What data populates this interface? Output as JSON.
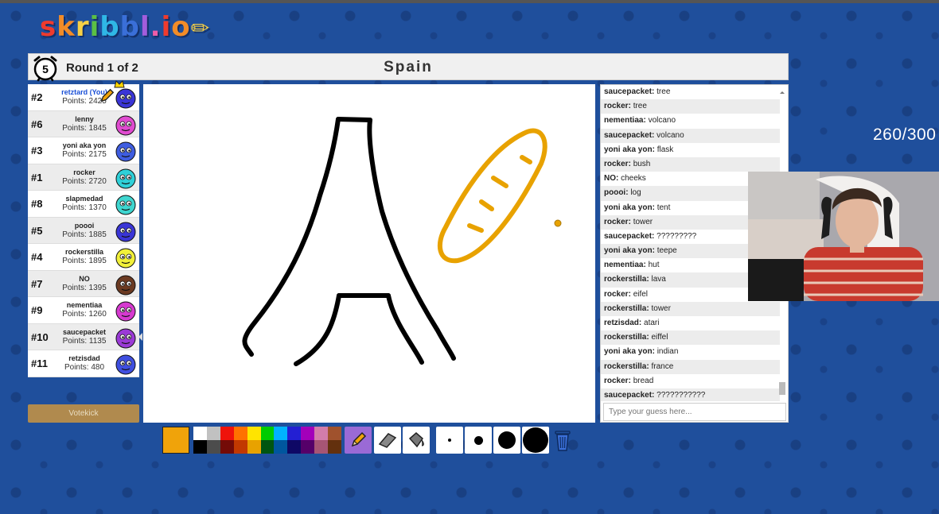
{
  "app": {
    "logo_letters": [
      "s",
      "k",
      "r",
      "i",
      "b",
      "b",
      "l",
      ".",
      "i",
      "o"
    ],
    "logo_colors": [
      "#ef3b2d",
      "#f28c28",
      "#f6d046",
      "#5bc044",
      "#2fb7e6",
      "#3a6fd8",
      "#a25ddc",
      "#ef5da8",
      "#ef3b2d",
      "#f28c28"
    ]
  },
  "header": {
    "timer": "5",
    "round": "Round 1 of 2",
    "word": "Spain"
  },
  "players": [
    {
      "rank": "#2",
      "name": "retztard (You)",
      "points": "Points: 2425",
      "self": true,
      "avatar": "#3a35d6",
      "drawing": true,
      "crown": true
    },
    {
      "rank": "#6",
      "name": "lenny",
      "points": "Points: 1845",
      "avatar": "#e04bd0"
    },
    {
      "rank": "#3",
      "name": "yoni aka yon",
      "points": "Points: 2175",
      "avatar": "#3f5de0"
    },
    {
      "rank": "#1",
      "name": "rocker",
      "points": "Points: 2720",
      "avatar": "#2fd0d8"
    },
    {
      "rank": "#8",
      "name": "slapmedad",
      "points": "Points: 1370",
      "avatar": "#3fd6d0"
    },
    {
      "rank": "#5",
      "name": "poooi",
      "points": "Points: 1885",
      "avatar": "#3a35d6"
    },
    {
      "rank": "#4",
      "name": "rockerstilla",
      "points": "Points: 1895",
      "avatar": "#f1f03a"
    },
    {
      "rank": "#7",
      "name": "NO",
      "points": "Points: 1395",
      "avatar": "#6b3a22"
    },
    {
      "rank": "#9",
      "name": "nementiaa",
      "points": "Points: 1260",
      "avatar": "#d63ad0"
    },
    {
      "rank": "#10",
      "name": "saucepacket",
      "points": "Points: 1135",
      "avatar": "#9a3ad6"
    },
    {
      "rank": "#11",
      "name": "retzisdad",
      "points": "Points: 480",
      "avatar": "#3f4fe0"
    }
  ],
  "speech_bubble": "???????????",
  "votekick_label": "Votekick",
  "toolbar": {
    "current_color": "#f0a30a",
    "palette": [
      "#ffffff",
      "#c1c1c1",
      "#ef130b",
      "#ff7100",
      "#ffe400",
      "#00cc00",
      "#00b2ff",
      "#231fd3",
      "#a300ba",
      "#d37caa",
      "#a0522d",
      "#000000",
      "#4c4c4c",
      "#740b07",
      "#c23800",
      "#e8a200",
      "#005510",
      "#00569e",
      "#0e0865",
      "#550069",
      "#a75574",
      "#63300d"
    ]
  },
  "chat": {
    "messages": [
      {
        "user": "saucepacket:",
        "text": "tree"
      },
      {
        "user": "rocker:",
        "text": "tree"
      },
      {
        "user": "nementiaa:",
        "text": "volcano"
      },
      {
        "user": "saucepacket:",
        "text": "volcano"
      },
      {
        "user": "yoni aka yon:",
        "text": "flask"
      },
      {
        "user": "rocker:",
        "text": "bush"
      },
      {
        "user": "NO:",
        "text": "cheeks"
      },
      {
        "user": "poooi:",
        "text": "log"
      },
      {
        "user": "yoni aka yon:",
        "text": "tent"
      },
      {
        "user": "rocker:",
        "text": "tower"
      },
      {
        "user": "saucepacket:",
        "text": "?????????"
      },
      {
        "user": "yoni aka yon:",
        "text": "teepe"
      },
      {
        "user": "nementiaa:",
        "text": "hut"
      },
      {
        "user": "rockerstilla:",
        "text": "lava"
      },
      {
        "user": "rocker:",
        "text": "eifel"
      },
      {
        "user": "rockerstilla:",
        "text": "tower"
      },
      {
        "user": "retzisdad:",
        "text": "atari"
      },
      {
        "user": "rockerstilla:",
        "text": "eiffel"
      },
      {
        "user": "yoni aka yon:",
        "text": "indian"
      },
      {
        "user": "rockerstilla:",
        "text": "france"
      },
      {
        "user": "rocker:",
        "text": "bread"
      },
      {
        "user": "saucepacket:",
        "text": "???????????"
      }
    ],
    "input_placeholder": "Type your guess here..."
  },
  "overlay": {
    "counter": "260/300"
  }
}
